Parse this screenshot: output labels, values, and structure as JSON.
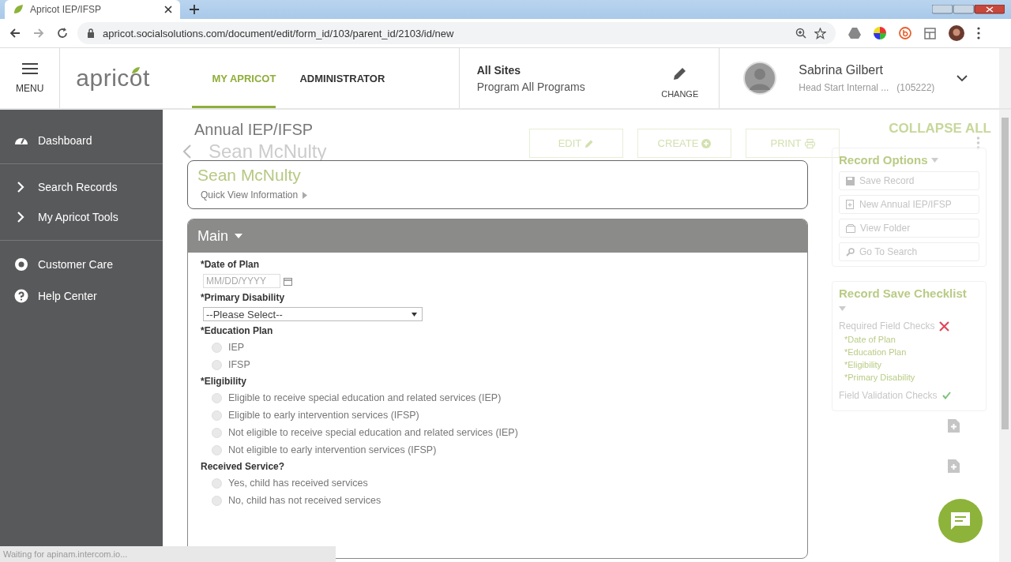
{
  "browser": {
    "tab_title": "Apricot IEP/IFSP",
    "url": "apricot.socialsolutions.com/document/edit/form_id/103/parent_id/2103/id/new"
  },
  "header": {
    "menu_label": "MENU",
    "logo": "apricot",
    "nav": [
      {
        "label": "MY APRICOT",
        "selected": true
      },
      {
        "label": "ADMINISTRATOR",
        "selected": false
      }
    ],
    "site": {
      "title": "All Sites",
      "program": "Program All Programs",
      "change_label": "CHANGE"
    },
    "user": {
      "name": "Sabrina Gilbert",
      "org": "Head Start Internal ...",
      "id": "(105222)"
    }
  },
  "sidebar": [
    {
      "label": "Dashboard"
    },
    {
      "label": "Search Records"
    },
    {
      "label": "My Apricot Tools"
    },
    {
      "label": "Customer Care"
    },
    {
      "label": "Help Center"
    }
  ],
  "page": {
    "title": "Annual IEP/IFSP",
    "subject": "Sean McNulty",
    "actions": [
      "EDIT",
      "CREATE",
      "PRINT"
    ],
    "collapse_all": "COLLAPSE ALL"
  },
  "record_options": {
    "title": "Record Options",
    "items": [
      "Save Record",
      "New Annual IEP/IFSP",
      "View Folder",
      "Go To Search"
    ]
  },
  "checklist": {
    "title": "Record Save Checklist",
    "sections": [
      {
        "label": "Required Field Checks",
        "passed": false,
        "items": [
          "*Date of Plan",
          "*Education Plan",
          "*Eligibility",
          "*Primary Disability"
        ]
      },
      {
        "label": "Field Validation Checks",
        "passed": true
      }
    ]
  },
  "form": {
    "subject": "Sean McNulty",
    "quick_view": "Quick View Information",
    "section": "Main",
    "fields": [
      {
        "kind": "date",
        "label": "*Date of Plan",
        "placeholder": "MM/DD/YYYY"
      },
      {
        "kind": "select",
        "label": "*Primary Disability",
        "value": "--Please Select--"
      },
      {
        "kind": "radio",
        "label": "*Education Plan",
        "options": [
          {
            "label": "IEP",
            "selected": false
          },
          {
            "label": "IFSP",
            "selected": false
          }
        ]
      },
      {
        "kind": "radio",
        "label": "*Eligibility",
        "options": [
          {
            "label": "Eligible to receive special education and related services (IEP)",
            "selected": false
          },
          {
            "label": "Eligible to early intervention services (IFSP)",
            "selected": false
          },
          {
            "label": "Not eligible to receive special education and related services (IEP)",
            "selected": false
          },
          {
            "label": "Not eligible to early intervention services (IFSP)",
            "selected": false
          }
        ]
      },
      {
        "kind": "radio",
        "label": "Received Service?",
        "options": [
          {
            "label": "Yes, child has received services",
            "selected": false
          },
          {
            "label": "No, child has not received services",
            "selected": false
          }
        ]
      }
    ]
  },
  "status_bar": "Waiting for apinam.intercom.io..."
}
